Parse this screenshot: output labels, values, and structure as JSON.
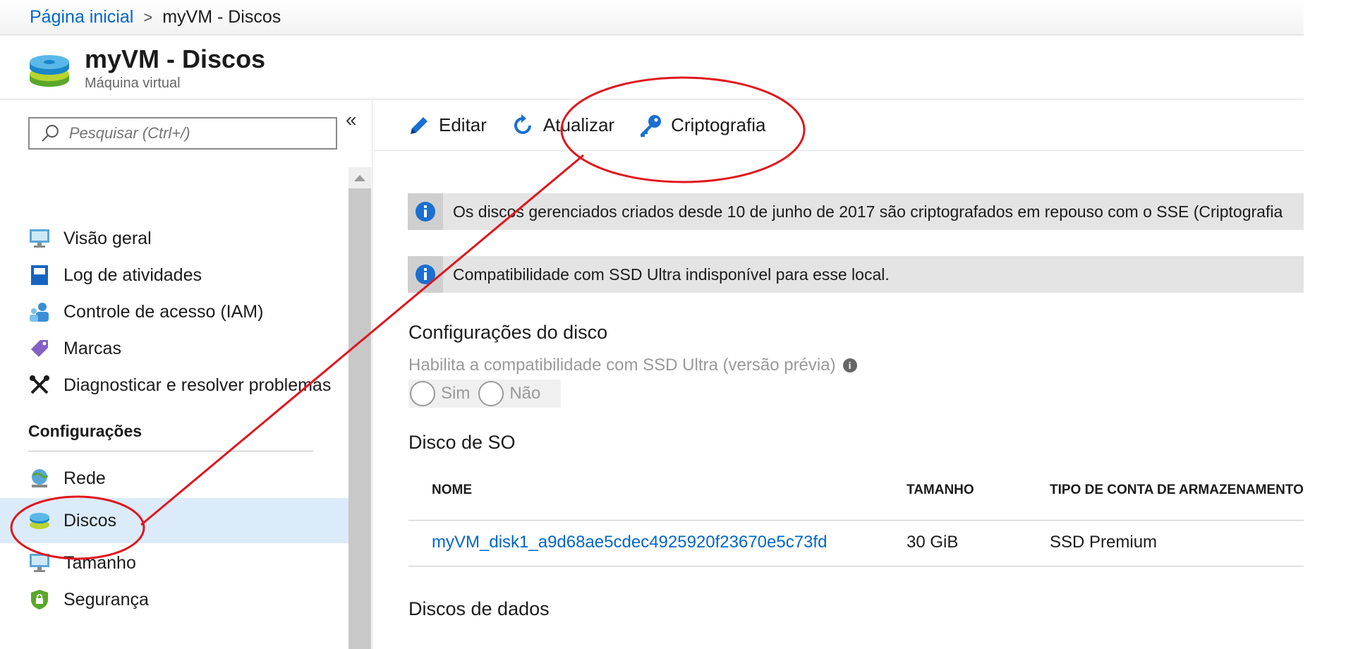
{
  "breadcrumb": {
    "home": "Página inicial",
    "separator": ">",
    "current": "myVM - Discos"
  },
  "header": {
    "title": "myVM - Discos",
    "subtitle": "Máquina virtual",
    "icon": "vm-disks-icon"
  },
  "sidebar": {
    "search_placeholder": "Pesquisar (Ctrl+/)",
    "collapse_glyph": "«",
    "items": [
      {
        "label": "Visão geral",
        "icon": "monitor-icon"
      },
      {
        "label": "Log de atividades",
        "icon": "activity-log-icon"
      },
      {
        "label": "Controle de acesso (IAM)",
        "icon": "iam-icon"
      },
      {
        "label": "Marcas",
        "icon": "tag-icon"
      },
      {
        "label": "Diagnosticar e resolver problemas",
        "icon": "wrench-icon"
      }
    ],
    "section_label": "Configurações",
    "settings_items": [
      {
        "label": "Rede",
        "icon": "network-icon"
      },
      {
        "label": "Discos",
        "icon": "disks-icon",
        "active": true
      },
      {
        "label": "Tamanho",
        "icon": "monitor-icon"
      },
      {
        "label": "Segurança",
        "icon": "shield-icon"
      }
    ]
  },
  "toolbar": {
    "edit": "Editar",
    "refresh": "Atualizar",
    "encryption": "Criptografia"
  },
  "info": [
    {
      "text": "Os discos gerenciados criados desde 10 de junho de 2017 são criptografados em repouso com o SSE (Criptografia"
    },
    {
      "text": "Compatibilidade com SSD Ultra indisponível para esse local."
    }
  ],
  "disk_config": {
    "heading": "Configurações do disco",
    "ultra_label": "Habilita a compatibilidade com SSD Ultra (versão prévia)",
    "info_glyph": "i",
    "options": [
      "Sim",
      "Não"
    ]
  },
  "os_disk": {
    "heading": "Disco de SO",
    "columns": [
      "NOME",
      "TAMANHO",
      "TIPO DE CONTA DE ARMAZENAMENTO"
    ],
    "row": {
      "name": "myVM_disk1_a9d68ae5cdec4925920f23670e5c73fd",
      "size": "30 GiB",
      "type": "SSD Premium"
    }
  },
  "data_disks": {
    "heading": "Discos de dados"
  },
  "colors": {
    "link": "#0066cc",
    "annotation": "#e0161e",
    "active_bg": "#dcebf9"
  }
}
